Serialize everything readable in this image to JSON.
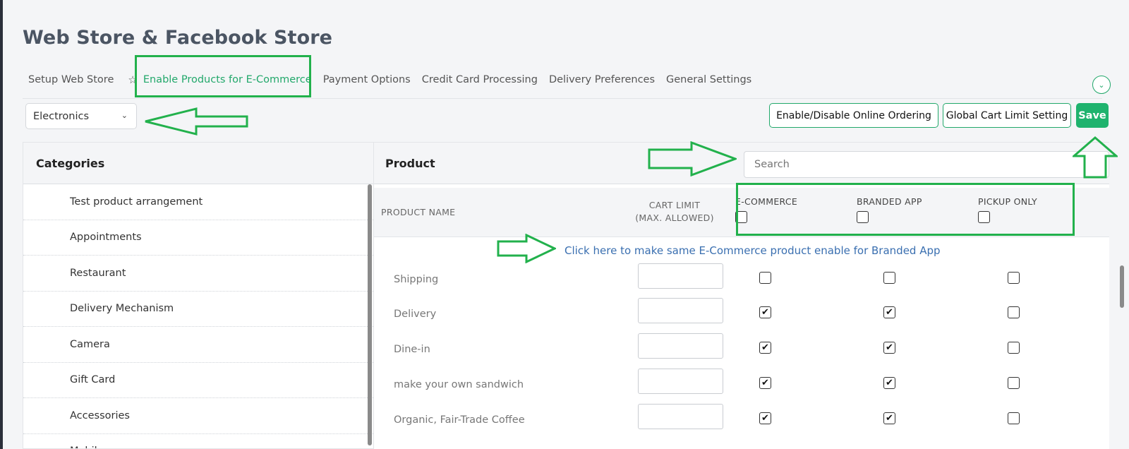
{
  "page_title": "Web Store & Facebook Store",
  "tabs": [
    {
      "label": "Setup Web Store"
    },
    {
      "label": "Enable Products for E-Commerce"
    },
    {
      "label": "Payment Options"
    },
    {
      "label": "Credit Card Processing"
    },
    {
      "label": "Delivery Preferences"
    },
    {
      "label": "General Settings"
    }
  ],
  "active_tab": "Enable Products for E-Commerce",
  "category_select": {
    "value": "Electronics"
  },
  "buttons": {
    "online_ordering": "Enable/Disable Online Ordering",
    "cart_limit": "Global Cart Limit Setting",
    "save": "Save"
  },
  "categories": {
    "header": "Categories",
    "items": [
      "Test product arrangement",
      "Appointments",
      "Restaurant",
      "Delivery Mechanism",
      "Camera",
      "Gift Card",
      "Accessories",
      "Mobiles"
    ]
  },
  "products": {
    "header": "Product",
    "search_placeholder": "Search",
    "columns": {
      "name": "PRODUCT NAME",
      "cart_limit": "CART LIMIT",
      "cart_limit_sub": "(MAX. ALLOWED)",
      "ecommerce": "E-COMMERCE",
      "branded_app": "BRANDED APP",
      "pickup_only": "PICKUP ONLY"
    },
    "enable_link": "Click here to make same E-Commerce product enable for Branded App",
    "rows": [
      {
        "name": "Shipping",
        "ecommerce": false,
        "branded_app": false,
        "pickup_only": false
      },
      {
        "name": "Delivery",
        "ecommerce": true,
        "branded_app": true,
        "pickup_only": false
      },
      {
        "name": "Dine-in",
        "ecommerce": true,
        "branded_app": true,
        "pickup_only": false
      },
      {
        "name": "make your own sandwich",
        "ecommerce": true,
        "branded_app": true,
        "pickup_only": false
      },
      {
        "name": "Organic, Fair-Trade Coffee",
        "ecommerce": true,
        "branded_app": true,
        "pickup_only": false
      }
    ]
  },
  "colors": {
    "accent": "#1fb36e",
    "annotation": "#22b14c",
    "link": "#3a6fb0"
  }
}
